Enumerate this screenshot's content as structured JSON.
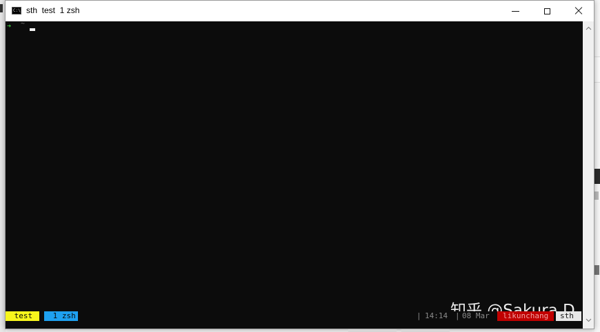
{
  "window": {
    "title": "sth  test  1 zsh",
    "icon_label": "C:\\",
    "buttons": [
      "minimize",
      "maximize",
      "close"
    ]
  },
  "terminal": {
    "prompt_arrow": "➜",
    "prompt_dir": "~",
    "cursor": "block"
  },
  "tmux": {
    "windows": [
      {
        "label": " test",
        "active": true,
        "color": "#f7f51c"
      },
      {
        "label": " 1 zsh",
        "active": false,
        "color": "#1ea0f0"
      }
    ],
    "separator": "|",
    "time": "14:14",
    "date": "08 Mar",
    "user": "likunchang",
    "host": "sth"
  },
  "watermark": {
    "text": "知乎 @Sakura.D"
  },
  "colors": {
    "terminal_bg": "#0c0c0c",
    "prompt": "#3ec43e",
    "user_bg": "#c00000",
    "host_bg": "#e8e8e8"
  },
  "icons": {
    "app": "console-icon",
    "minimize": "minimize-icon",
    "maximize": "maximize-icon",
    "close": "close-icon",
    "scroll_up": "chevron-up-icon",
    "scroll_down": "chevron-down-icon"
  }
}
